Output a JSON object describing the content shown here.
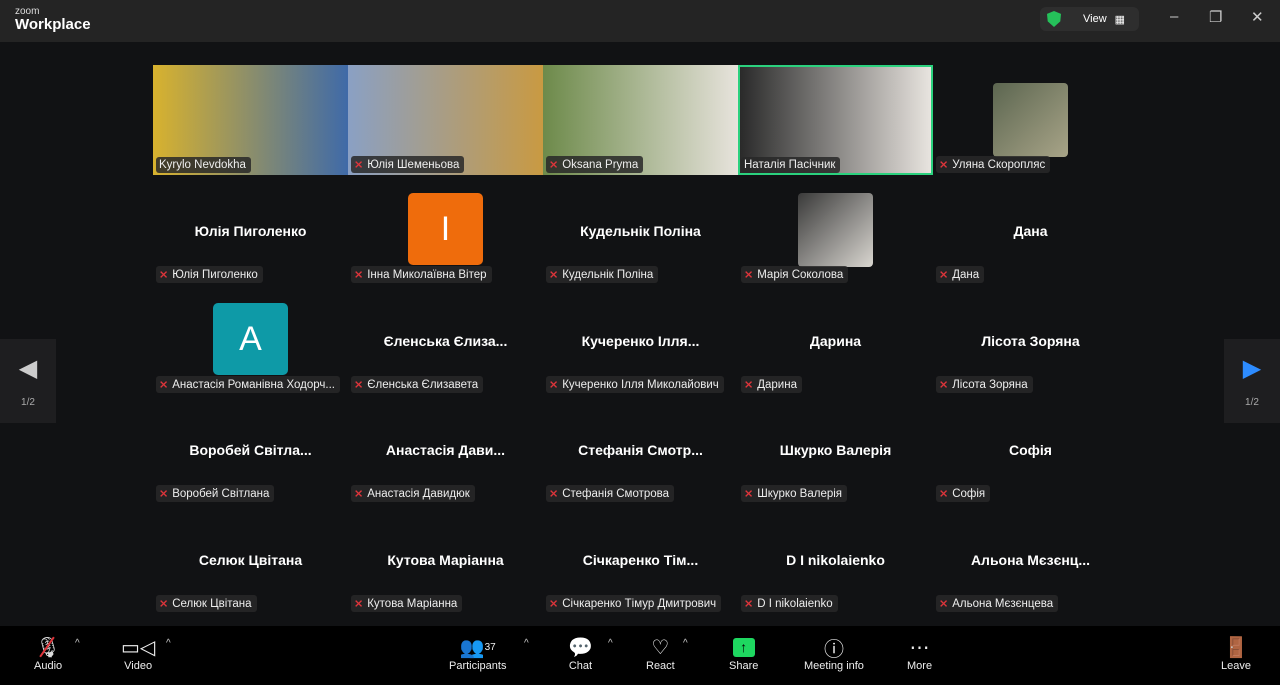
{
  "app": {
    "brand_small": "zoom",
    "brand": "Workplace",
    "view_label": "View"
  },
  "pager": {
    "left": "1/2",
    "right": "1/2"
  },
  "tiles": [
    {
      "label": "Kyrylo Nevdokha",
      "muted": false,
      "kind": "video",
      "colors": [
        "#d8b22e",
        "#3f6aa8"
      ]
    },
    {
      "label": "Юлія Шеменьова",
      "muted": true,
      "kind": "video",
      "colors": [
        "#8aa0c4",
        "#c99a42"
      ]
    },
    {
      "label": "Oksana Pryma",
      "muted": true,
      "kind": "video",
      "colors": [
        "#6d8a4a",
        "#e7e3dc"
      ]
    },
    {
      "label": "Наталія Пасічник",
      "muted": false,
      "kind": "video",
      "active": true,
      "colors": [
        "#2a2a2a",
        "#e8e4df"
      ]
    },
    {
      "label": "Уляна Скоропляс",
      "muted": true,
      "kind": "thumb",
      "colors": [
        "#5c6650",
        "#a8a488"
      ]
    },
    {
      "name": "Юлія Пиголенко",
      "label": "Юлія Пиголенко",
      "muted": true,
      "kind": "name"
    },
    {
      "label": "Інна Миколаївна Вітер",
      "muted": true,
      "kind": "avatar",
      "letter": "I",
      "color": "#ef6c0c"
    },
    {
      "name": "Кудельнік  Поліна",
      "label": "Кудельнік Поліна",
      "muted": true,
      "kind": "name"
    },
    {
      "label": "Марія Соколова",
      "muted": true,
      "kind": "thumb",
      "colors": [
        "#3a3a3a",
        "#d9d6d0"
      ]
    },
    {
      "name": "Дана",
      "label": "Дана",
      "muted": true,
      "kind": "name"
    },
    {
      "label": "Анастасія Романівна Ходорч...",
      "muted": true,
      "kind": "avatar",
      "letter": "A",
      "color": "#0e9aa7"
    },
    {
      "name": "Єленська Єлиза...",
      "label": "Єленська Єлизавета",
      "muted": true,
      "kind": "name"
    },
    {
      "name": "Кучеренко Ілля...",
      "label": "Кучеренко Ілля Миколайович",
      "muted": true,
      "kind": "name"
    },
    {
      "name": "Дарина",
      "label": "Дарина",
      "muted": true,
      "kind": "name"
    },
    {
      "name": "Лісота Зоряна",
      "label": "Лісота Зоряна",
      "muted": true,
      "kind": "name"
    },
    {
      "name": "Воробей  Світла...",
      "label": "Воробей Світлана",
      "muted": true,
      "kind": "name"
    },
    {
      "name": "Анастасія Дави...",
      "label": "Анастасія Давидюк",
      "muted": true,
      "kind": "name"
    },
    {
      "name": "Стефанія Смотр...",
      "label": "Стефанія Смотрова",
      "muted": true,
      "kind": "name"
    },
    {
      "name": "Шкурко Валерія",
      "label": "Шкурко Валерія",
      "muted": true,
      "kind": "name"
    },
    {
      "name": "Софія",
      "label": "Софія",
      "muted": true,
      "kind": "name"
    },
    {
      "name": "Селюк Цвітана",
      "label": "Селюк Цвітана",
      "muted": true,
      "kind": "name"
    },
    {
      "name": "Кутова Маріанна",
      "label": "Кутова Маріанна",
      "muted": true,
      "kind": "name"
    },
    {
      "name": "Січкаренко  Тім...",
      "label": "Січкаренко Тімур Дмитрович",
      "muted": true,
      "kind": "name"
    },
    {
      "name": "D I nikolaienko",
      "label": "D I nikolaienko",
      "muted": true,
      "kind": "name"
    },
    {
      "name": "Альона  Мєзєнц...",
      "label": "Альона Мєзєнцева",
      "muted": true,
      "kind": "name"
    }
  ],
  "toolbar": {
    "audio": "Audio",
    "video": "Video",
    "participants": "Participants",
    "participant_count": "37",
    "chat": "Chat",
    "react": "React",
    "share": "Share",
    "meeting_info": "Meeting info",
    "more": "More",
    "leave": "Leave",
    "share_color": "#1ed760",
    "active_speaker_color": "#2bd17e"
  }
}
